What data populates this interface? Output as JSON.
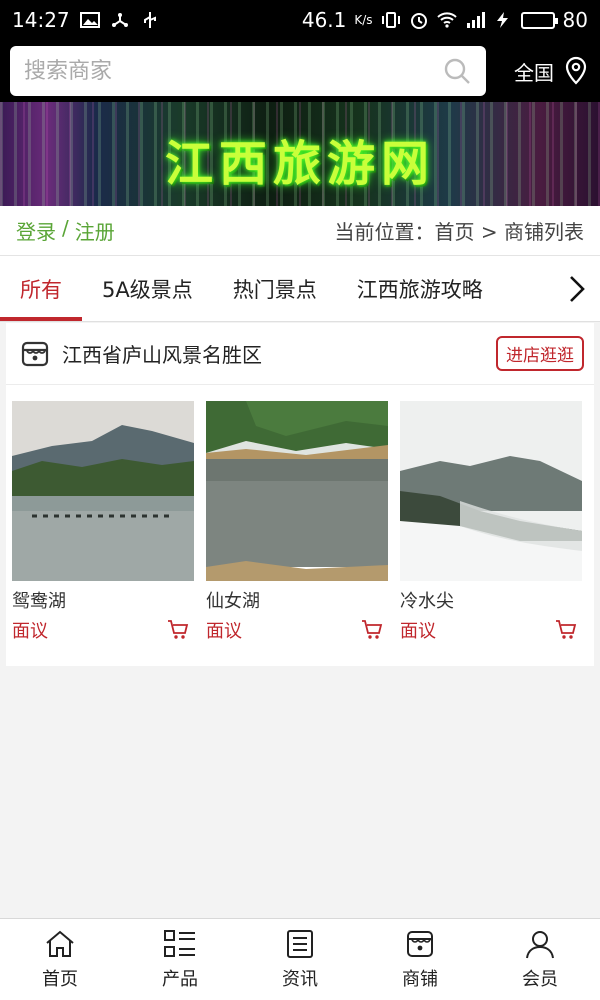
{
  "status_bar": {
    "time": "14:27",
    "speed": "46.1",
    "speed_unit": "K/s",
    "battery": "80"
  },
  "search": {
    "placeholder": "搜索商家",
    "region": "全国"
  },
  "banner": {
    "title": "江西旅游网"
  },
  "auth": {
    "login": "登录",
    "separator": "/",
    "register": "注册",
    "location": "当前位置：首页 > 商铺列表"
  },
  "tabs": [
    {
      "label": "所有",
      "active": true
    },
    {
      "label": "5A级景点"
    },
    {
      "label": "热门景点"
    },
    {
      "label": "江西旅游攻略"
    }
  ],
  "shop": {
    "name": "江西省庐山风景名胜区",
    "enter_label": "进店逛逛",
    "products": [
      {
        "name": "鸳鸯湖",
        "price": "面议"
      },
      {
        "name": "仙女湖",
        "price": "面议"
      },
      {
        "name": "冷水尖",
        "price": "面议"
      }
    ]
  },
  "bottom_nav": [
    {
      "label": "首页",
      "icon": "home-icon"
    },
    {
      "label": "产品",
      "icon": "grid-list-icon"
    },
    {
      "label": "资讯",
      "icon": "news-icon"
    },
    {
      "label": "商铺",
      "icon": "shop-icon"
    },
    {
      "label": "会员",
      "icon": "user-icon"
    }
  ],
  "colors": {
    "accent": "#c0272d",
    "auth_green": "#5aa537",
    "header_bg": "#000000"
  }
}
